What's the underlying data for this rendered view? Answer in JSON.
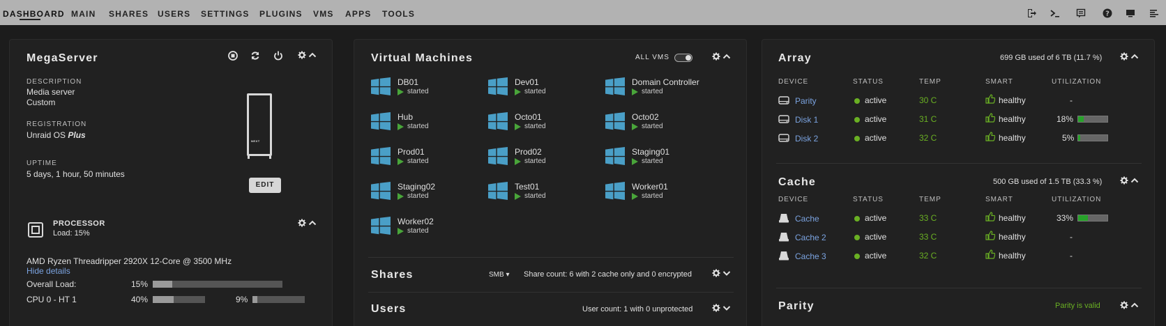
{
  "nav": {
    "tabs": [
      "DASHBOARD",
      "MAIN",
      "SHARES",
      "USERS",
      "SETTINGS",
      "PLUGINS",
      "VMS",
      "APPS",
      "TOOLS"
    ],
    "right_icons": [
      "logout-icon",
      "terminal-icon",
      "feedback-icon",
      "help-icon",
      "monitor-icon",
      "log-icon"
    ]
  },
  "server": {
    "name": "MegaServer",
    "description_label": "DESCRIPTION",
    "description_line1": "Media server",
    "description_line2": "Custom",
    "registration_label": "REGISTRATION",
    "registration_prefix": "Unraid OS ",
    "registration_plan": "Plus",
    "uptime_label": "UPTIME",
    "uptime_value": "5 days, 1 hour, 50 minutes",
    "case_logo": "NEXT",
    "edit_label": "EDIT"
  },
  "processor": {
    "title": "PROCESSOR",
    "load": "Load: 15%",
    "model": "AMD Ryzen Threadripper 2920X 12-Core @ 3500 MHz",
    "hide_details": "Hide details",
    "overall_label": "Overall Load:",
    "overall_value": "15%",
    "overall_fraction": 0.15,
    "cpu0_label": "CPU 0 - HT 1",
    "cpu0_value": "40%",
    "cpu0_fraction": 0.4,
    "ht1_value": "9%",
    "ht1_fraction": 0.09
  },
  "vms": {
    "title": "Virtual Machines",
    "all_vms_label": "ALL VMS",
    "items": [
      {
        "name": "DB01",
        "state": "started"
      },
      {
        "name": "Dev01",
        "state": "started"
      },
      {
        "name": "Domain Controller",
        "state": "started"
      },
      {
        "name": "Hub",
        "state": "started"
      },
      {
        "name": "Octo01",
        "state": "started"
      },
      {
        "name": "Octo02",
        "state": "started"
      },
      {
        "name": "Prod01",
        "state": "started"
      },
      {
        "name": "Prod02",
        "state": "started"
      },
      {
        "name": "Staging01",
        "state": "started"
      },
      {
        "name": "Staging02",
        "state": "started"
      },
      {
        "name": "Test01",
        "state": "started"
      },
      {
        "name": "Worker01",
        "state": "started"
      },
      {
        "name": "Worker02",
        "state": "started"
      }
    ]
  },
  "shares": {
    "title": "Shares",
    "protocol": "SMB",
    "summary": "Share count: 6 with 2 cache only and 0 encrypted"
  },
  "users": {
    "title": "Users",
    "summary": "User count: 1 with 0 unprotected"
  },
  "array": {
    "title": "Array",
    "usage": "699 GB used of 6 TB (11.7 %)",
    "headers": [
      "DEVICE",
      "STATUS",
      "TEMP",
      "SMART",
      "UTILIZATION"
    ],
    "rows": [
      {
        "device": "Parity",
        "status": "active",
        "temp": "30 C",
        "smart": "healthy",
        "util": "-",
        "fraction": null
      },
      {
        "device": "Disk 1",
        "status": "active",
        "temp": "31 C",
        "smart": "healthy",
        "util": "18%",
        "fraction": 0.18
      },
      {
        "device": "Disk 2",
        "status": "active",
        "temp": "32 C",
        "smart": "healthy",
        "util": "5%",
        "fraction": 0.05
      }
    ]
  },
  "cache": {
    "title": "Cache",
    "usage": "500 GB used of 1.5 TB (33.3 %)",
    "headers": [
      "DEVICE",
      "STATUS",
      "TEMP",
      "SMART",
      "UTILIZATION"
    ],
    "rows": [
      {
        "device": "Cache",
        "status": "active",
        "temp": "33 C",
        "smart": "healthy",
        "util": "33%",
        "fraction": 0.33
      },
      {
        "device": "Cache 2",
        "status": "active",
        "temp": "33 C",
        "smart": "healthy",
        "util": "-",
        "fraction": null
      },
      {
        "device": "Cache 3",
        "status": "active",
        "temp": "32 C",
        "smart": "healthy",
        "util": "-",
        "fraction": null
      }
    ]
  },
  "parity": {
    "title": "Parity",
    "status": "Parity is valid"
  },
  "colors": {
    "nav_bg": "#b2b2b2",
    "page_bg": "#1c1c1c",
    "panel_bg": "#212121",
    "accent_green": "#6ab023",
    "link_blue": "#7ba3e0",
    "windows_blue": "#4a9fc7"
  }
}
